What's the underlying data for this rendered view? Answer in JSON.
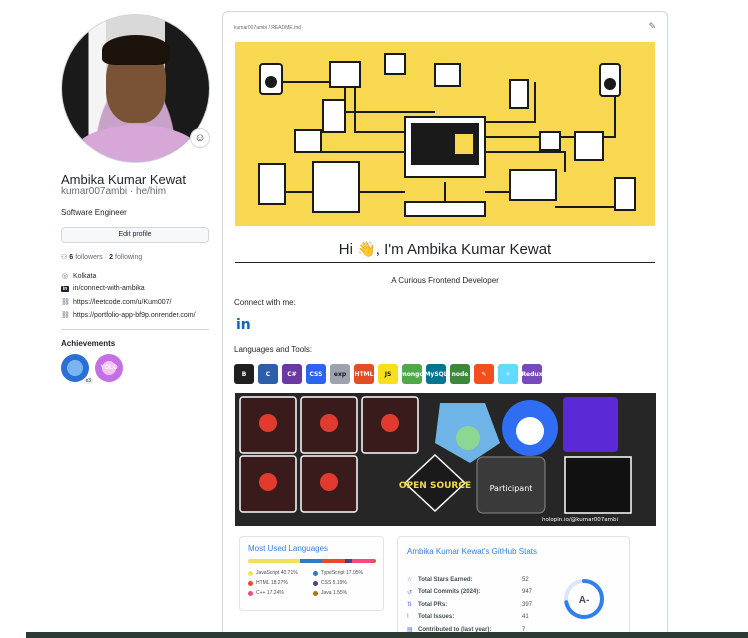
{
  "profile": {
    "name": "Ambika Kumar Kewat",
    "login": "kumar007ambi · he/him",
    "bio": "Software Engineer",
    "edit_label": "Edit profile",
    "followers_count": "6",
    "followers_label": "followers ·",
    "following_count": "2",
    "following_label": "following",
    "status_emoji": "☺",
    "location": "Kolkata",
    "linkedin": "in/connect-with-ambika",
    "link1": "https://leetcode.com/u/Kum007/",
    "link2": "https://portfolio-app-bf9p.onrender.com/"
  },
  "achievements": {
    "title": "Achievements",
    "badge1_count": "x3",
    "badge2_text": "YOLO"
  },
  "readme": {
    "path": "kumar007ambi / README.md",
    "heading": "Hi 👋, I'm Ambika Kumar Kewat",
    "subtitle": "A Curious Frontend Developer",
    "connect_label": "Connect with me:",
    "linkedin_icon": "in",
    "langs_label": "Languages and Tools:",
    "tools": [
      {
        "label": "B",
        "color": "#1f1f1f"
      },
      {
        "label": "C",
        "color": "#2d5fa8"
      },
      {
        "label": "C#",
        "color": "#6a3aa2"
      },
      {
        "label": "CSS",
        "color": "#2965f1"
      },
      {
        "label": "exp",
        "color": "#9ca3af"
      },
      {
        "label": "HTML",
        "color": "#e34c26"
      },
      {
        "label": "JS",
        "color": "#f7df1e"
      },
      {
        "label": "mongo",
        "color": "#4ea94b"
      },
      {
        "label": "MySQL",
        "color": "#00758f"
      },
      {
        "label": "node",
        "color": "#3c873a"
      },
      {
        "label": "✎",
        "color": "#f24e1e"
      },
      {
        "label": "⚛",
        "color": "#61dafb"
      },
      {
        "label": "Redux",
        "color": "#764abc"
      }
    ],
    "strip_caption": "holopin.io/@kumar007ambi",
    "participant_text": "Participant",
    "opensource_text": "OPEN SOURCE"
  },
  "languages_card": {
    "title": "Most Used Languages",
    "items": [
      {
        "name": "JavaScript 40.71%",
        "color": "#f1e05a",
        "pct": 40.71
      },
      {
        "name": "TypeScript 17.05%",
        "color": "#3178c6",
        "pct": 17.05
      },
      {
        "name": "HTML 18.27%",
        "color": "#e34c26",
        "pct": 18.27
      },
      {
        "name": "CSS 5.19%",
        "color": "#563d7c",
        "pct": 5.19
      },
      {
        "name": "C++ 17.24%",
        "color": "#f34b7d",
        "pct": 17.24
      },
      {
        "name": "Java 1.55%",
        "color": "#b07219",
        "pct": 1.55
      }
    ]
  },
  "stats_card": {
    "title": "Ambika Kumar Kewat's GitHub Stats",
    "rows": [
      {
        "icon": "☆",
        "label": "Total Stars Earned:",
        "value": "52"
      },
      {
        "icon": "↺",
        "label": "Total Commits (2024):",
        "value": "947"
      },
      {
        "icon": "⇅",
        "label": "Total PRs:",
        "value": "397"
      },
      {
        "icon": "!",
        "label": "Total Issues:",
        "value": "41"
      },
      {
        "icon": "▤",
        "label": "Contributed to (last year):",
        "value": "7"
      }
    ],
    "grade": "A-",
    "grade_progress": 0.72
  }
}
